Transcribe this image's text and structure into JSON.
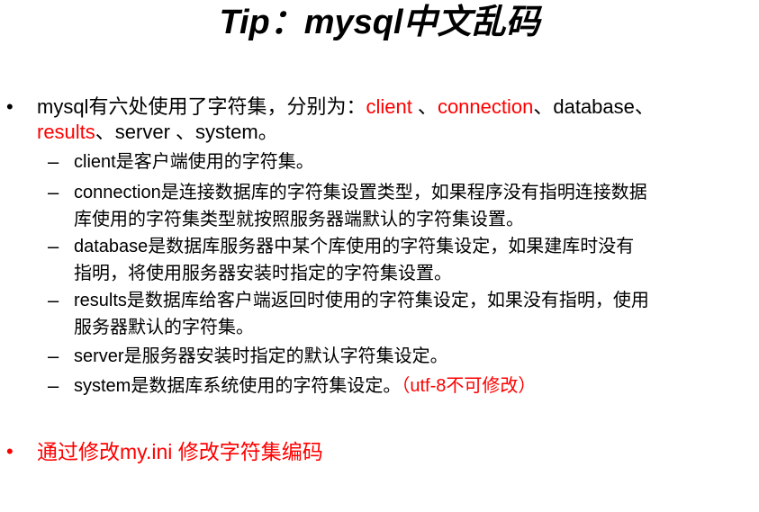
{
  "title": "Tip：mysql中文乱码",
  "bullet_symbol": "•",
  "dash_symbol": "–",
  "intro": {
    "prefix": "mysql有六处使用了字符集，分别为：",
    "client": "client",
    "sep1": " 、",
    "connection": "connection",
    "sep2": "、database、",
    "results": "results",
    "suffix": "、server 、system。"
  },
  "items": [
    {
      "lines": [
        "client是客户端使用的字符集。"
      ]
    },
    {
      "lines": [
        "connection是连接数据库的字符集设置类型，如果程序没有指明连接数据",
        "库使用的字符集类型就按照服务器端默认的字符集设置。"
      ]
    },
    {
      "lines": [
        "database是数据库服务器中某个库使用的字符集设定，如果建库时没有",
        "指明，将使用服务器安装时指定的字符集设置。"
      ]
    },
    {
      "lines": [
        "results是数据库给客户端返回时使用的字符集设定，如果没有指明，使用",
        "服务器默认的字符集。"
      ]
    },
    {
      "lines": [
        "server是服务器安装时指定的默认字符集设定。"
      ]
    },
    {
      "lines": [
        "system是数据库系统使用的字符集设定。"
      ],
      "note": "（utf-8不可修改）"
    }
  ],
  "footer": "通过修改my.ini 修改字符集编码",
  "colors": {
    "accent": "#ff0000",
    "text": "#000000",
    "background": "#ffffff"
  }
}
